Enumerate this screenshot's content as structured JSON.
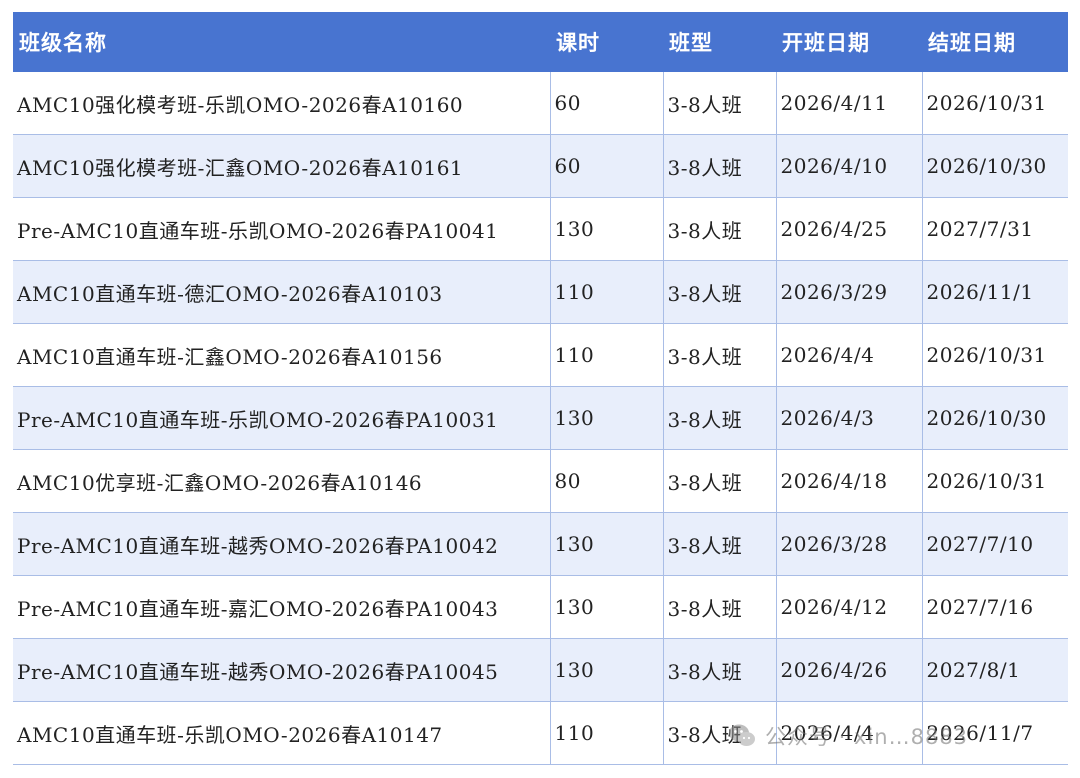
{
  "table": {
    "headers": [
      "班级名称",
      "课时",
      "班型",
      "开班日期",
      "结班日期"
    ],
    "rows": [
      [
        "AMC10强化模考班-乐凯OMO-2026春A10160",
        "60",
        "3-8人班",
        "2026/4/11",
        "2026/10/31"
      ],
      [
        "AMC10强化模考班-汇鑫OMO-2026春A10161",
        "60",
        "3-8人班",
        "2026/4/10",
        "2026/10/30"
      ],
      [
        "Pre-AMC10直通车班-乐凯OMO-2026春PA10041",
        "130",
        "3-8人班",
        "2026/4/25",
        "2027/7/31"
      ],
      [
        "AMC10直通车班-德汇OMO-2026春A10103",
        "110",
        "3-8人班",
        "2026/3/29",
        "2026/11/1"
      ],
      [
        "AMC10直通车班-汇鑫OMO-2026春A10156",
        "110",
        "3-8人班",
        "2026/4/4",
        "2026/10/31"
      ],
      [
        "Pre-AMC10直通车班-乐凯OMO-2026春PA10031",
        "130",
        "3-8人班",
        "2026/4/3",
        "2026/10/30"
      ],
      [
        "AMC10优享班-汇鑫OMO-2026春A10146",
        "80",
        "3-8人班",
        "2026/4/18",
        "2026/10/31"
      ],
      [
        "Pre-AMC10直通车班-越秀OMO-2026春PA10042",
        "130",
        "3-8人班",
        "2026/3/28",
        "2027/7/10"
      ],
      [
        "Pre-AMC10直通车班-嘉汇OMO-2026春PA10043",
        "130",
        "3-8人班",
        "2026/4/12",
        "2027/7/16"
      ],
      [
        "Pre-AMC10直通车班-越秀OMO-2026春PA10045",
        "130",
        "3-8人班",
        "2026/4/26",
        "2027/8/1"
      ],
      [
        "AMC10直通车班-乐凯OMO-2026春A10147",
        "110",
        "3-8人班",
        "2026/4/4",
        "2026/11/7"
      ]
    ]
  },
  "watermark": {
    "icon": "wechat-icon",
    "text": "公众号 · xin…8883"
  },
  "colors": {
    "header_bg": "#4874d0",
    "header_text": "#ffffff",
    "row_alt_bg": "#e8eefb",
    "grid_line": "#a9bde6"
  }
}
